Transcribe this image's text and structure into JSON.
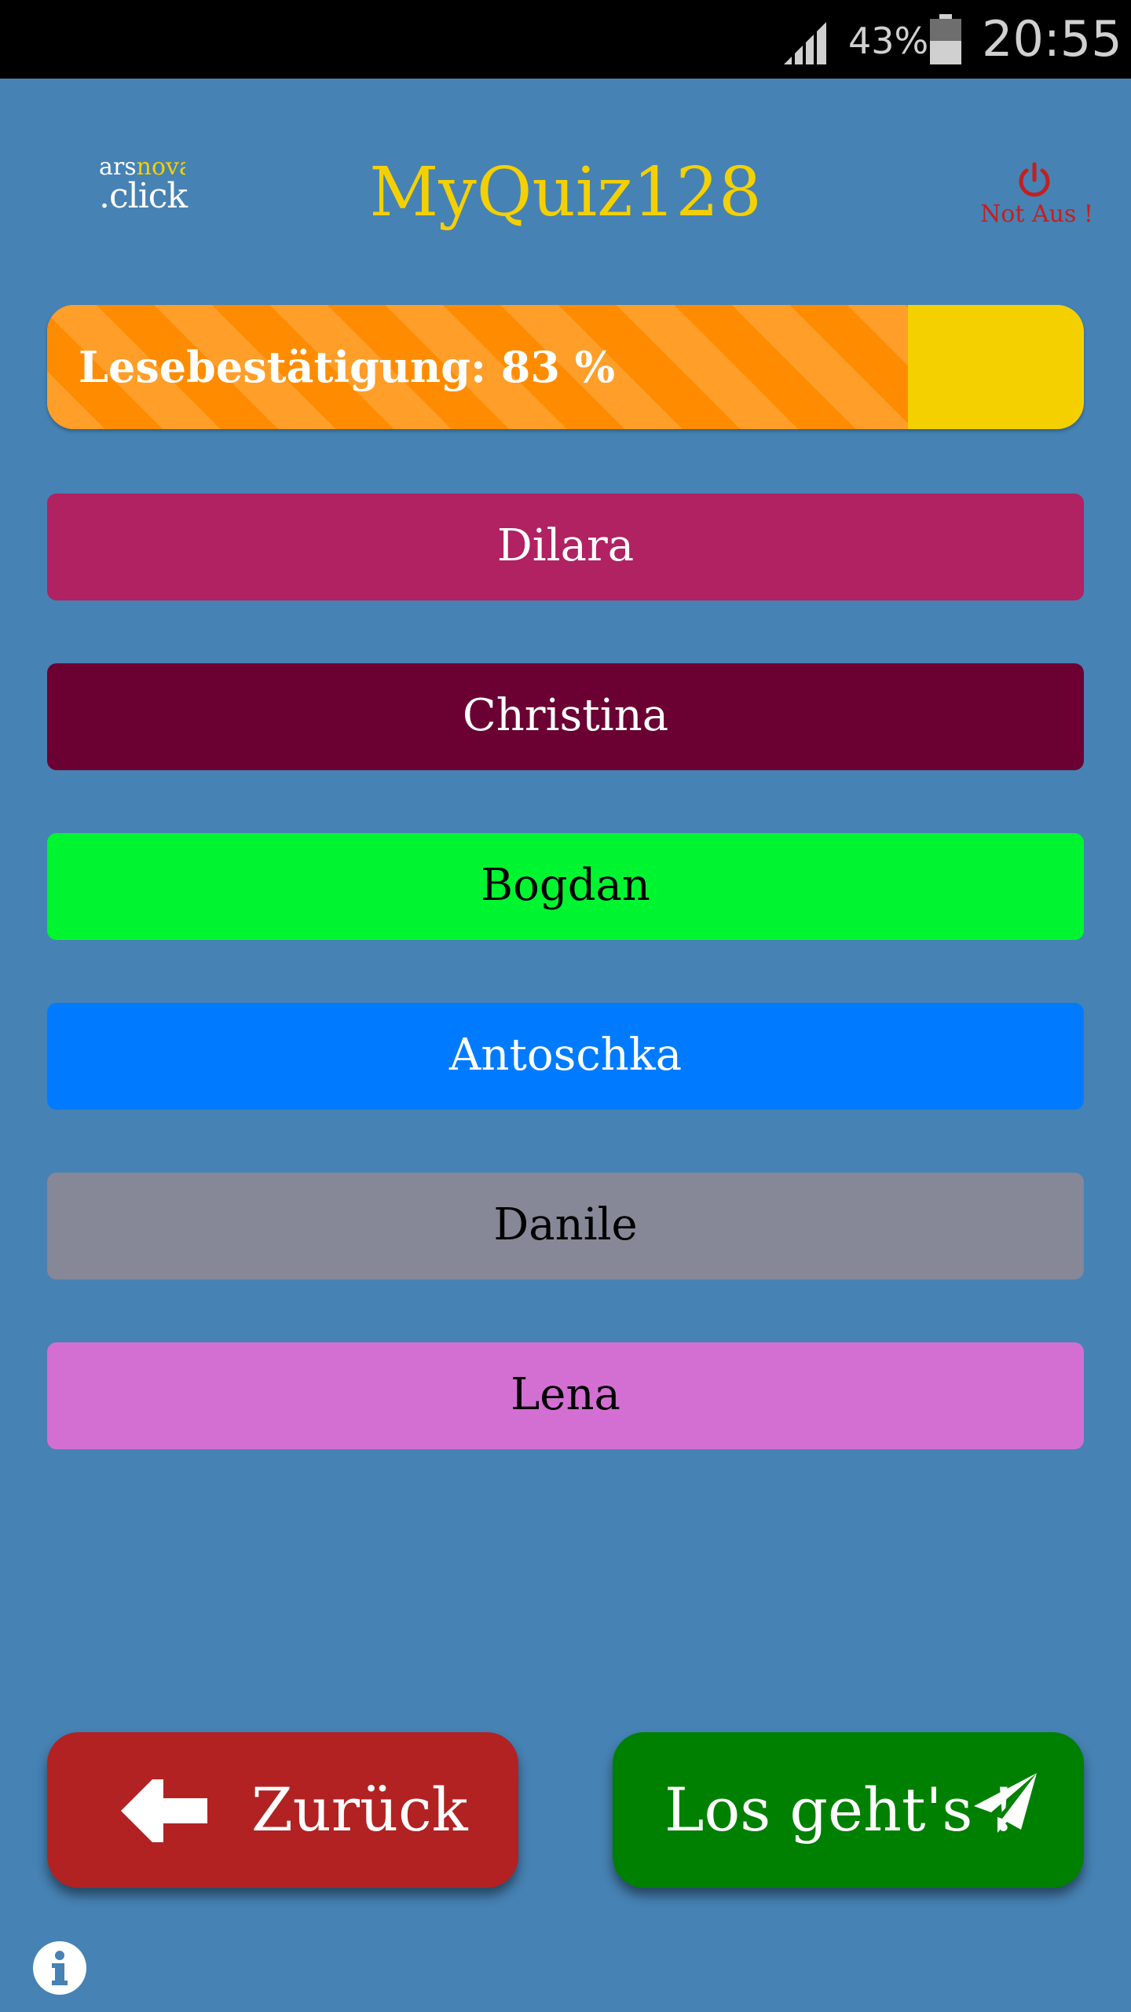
{
  "status_bar": {
    "battery_percent": "43%",
    "time": "20:55"
  },
  "header": {
    "logo": {
      "top_a": "ars",
      "top_b": "nova",
      "bottom": ".click"
    },
    "title": "MyQuiz128",
    "power_label": "Not Aus !"
  },
  "progress": {
    "label": "Lesebestätigung: 83 %",
    "value_percent": 83
  },
  "answers": [
    {
      "label": "Dilara",
      "color": "#b02262",
      "text_color": "#ffffff"
    },
    {
      "label": "Christina",
      "color": "#6b0033",
      "text_color": "#ffffff"
    },
    {
      "label": "Bogdan",
      "color": "#00f531",
      "text_color": "#000000"
    },
    {
      "label": "Antoschka",
      "color": "#007bff",
      "text_color": "#ffffff"
    },
    {
      "label": "Danile",
      "color": "#868897",
      "text_color": "#000000"
    },
    {
      "label": "Lena",
      "color": "#d36fd3",
      "text_color": "#000000"
    }
  ],
  "footer": {
    "back_label": "Zurück",
    "go_label": "Los geht's !"
  },
  "icons": {
    "signal": "signal-icon",
    "battery": "battery-icon",
    "power": "power-icon",
    "back": "arrow-left-icon",
    "go": "paper-plane-icon",
    "info": "info-icon"
  },
  "colors": {
    "background": "#4682b4",
    "title": "#f5d000",
    "progress_fill": "#ff8c00",
    "progress_track": "#f5d000",
    "back_button": "#b22222",
    "go_button": "#008000",
    "power": "#c41f1f"
  }
}
